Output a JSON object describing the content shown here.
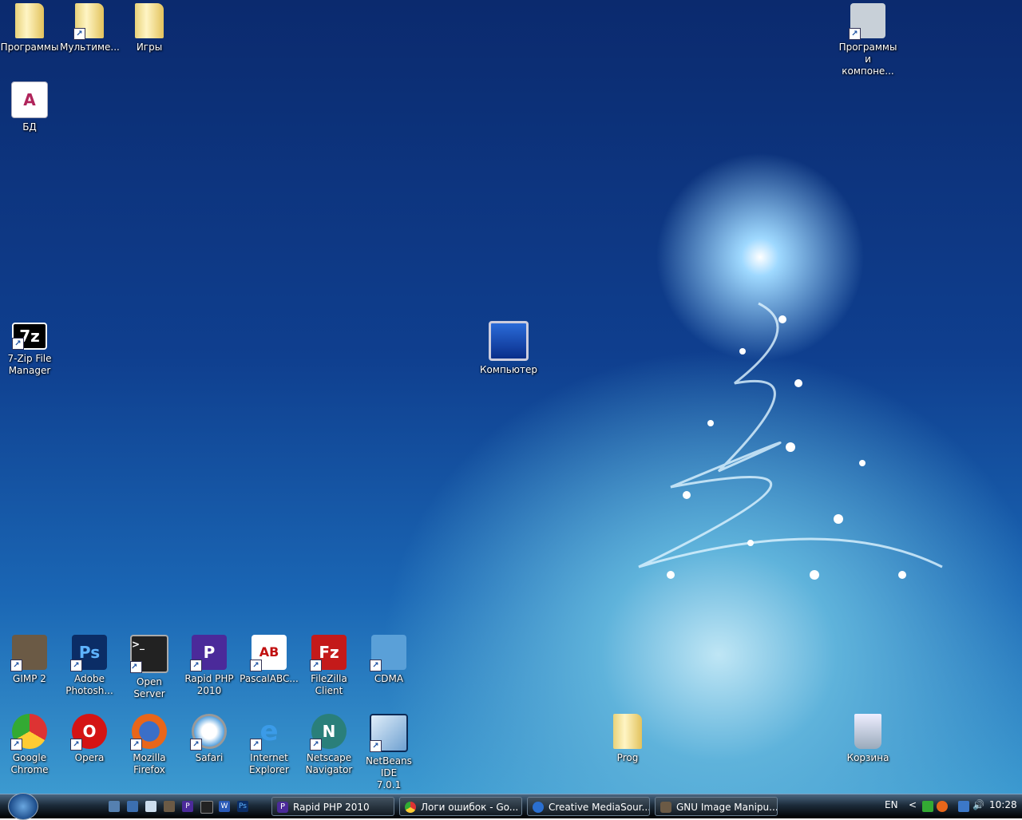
{
  "desktop": {
    "icons": [
      {
        "label": "Программы",
        "icon": "folder-icon"
      },
      {
        "label": "Мультиме...",
        "icon": "folder-shortcut-icon"
      },
      {
        "label": "Игры",
        "icon": "folder-icon"
      },
      {
        "label": "Программы\nи компоне...",
        "icon": "programs-features-icon"
      },
      {
        "label": "БД",
        "icon": "access-database-icon"
      },
      {
        "label": "7-Zip File\nManager",
        "icon": "7zip-icon"
      },
      {
        "label": "Компьютер",
        "icon": "computer-icon"
      },
      {
        "label": "GIMP 2",
        "icon": "gimp-icon"
      },
      {
        "label": "Adobe\nPhotosh...",
        "icon": "photoshop-icon"
      },
      {
        "label": "Open Server",
        "icon": "terminal-icon"
      },
      {
        "label": "Rapid PHP\n2010",
        "icon": "rapid-php-icon"
      },
      {
        "label": "PascalABC...",
        "icon": "pascalabc-icon"
      },
      {
        "label": "FileZilla\nClient",
        "icon": "filezilla-icon"
      },
      {
        "label": "CDMA",
        "icon": "network-icon"
      },
      {
        "label": "Google\nChrome",
        "icon": "chrome-icon"
      },
      {
        "label": "Opera",
        "icon": "opera-icon"
      },
      {
        "label": "Mozilla\nFirefox",
        "icon": "firefox-icon"
      },
      {
        "label": "Safari",
        "icon": "safari-icon"
      },
      {
        "label": "Internet\nExplorer",
        "icon": "ie-icon"
      },
      {
        "label": "Netscape\nNavigator",
        "icon": "netscape-icon"
      },
      {
        "label": "NetBeans IDE\n7.0.1",
        "icon": "netbeans-icon"
      },
      {
        "label": "Prog",
        "icon": "folder-icon"
      },
      {
        "label": "Корзина",
        "icon": "recycle-bin-icon"
      }
    ]
  },
  "taskbar": {
    "quicklaunch": [
      "Ps",
      "W",
      "P"
    ],
    "tasks": [
      {
        "label": "Rapid PHP 2010",
        "icon": "P"
      },
      {
        "label": "Логи ошибок - Go...",
        "icon": "chrome"
      },
      {
        "label": "Creative MediaSour...",
        "icon": "C"
      },
      {
        "label": "GNU Image Manipu...",
        "icon": "gimp"
      }
    ],
    "lang": "EN",
    "tray_expand": "<",
    "clock": "10:28"
  }
}
